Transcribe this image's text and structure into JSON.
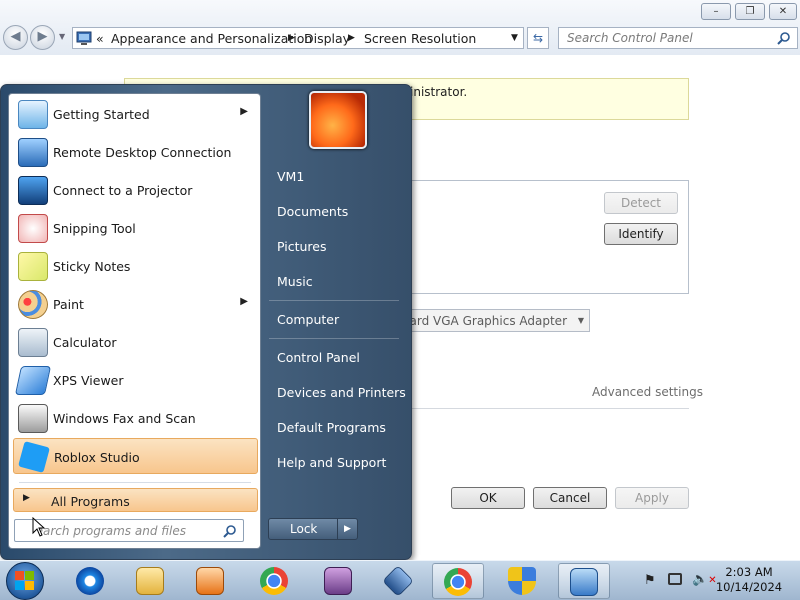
{
  "window": {
    "controls": [
      "–",
      "❐",
      "✕"
    ],
    "address": {
      "segments": [
        "Appearance and Personalization",
        "Display",
        "Screen Resolution"
      ]
    },
    "search_placeholder": "Search Control Panel"
  },
  "content": {
    "infobar_text": "inistrator.",
    "detect_label": "Detect",
    "identify_label": "Identify",
    "adapter_text": "andard VGA Graphics Adapter",
    "advanced_label": "Advanced settings",
    "ok_label": "OK",
    "cancel_label": "Cancel",
    "apply_label": "Apply"
  },
  "start_menu": {
    "programs": [
      {
        "label": "Getting Started",
        "icon": "getting-started-icon",
        "submenu": true
      },
      {
        "label": "Remote Desktop Connection",
        "icon": "remote-desktop-icon",
        "submenu": false
      },
      {
        "label": "Connect to a Projector",
        "icon": "projector-icon",
        "submenu": false
      },
      {
        "label": "Snipping Tool",
        "icon": "scissors-icon",
        "submenu": false
      },
      {
        "label": "Sticky Notes",
        "icon": "sticky-notes-icon",
        "submenu": false
      },
      {
        "label": "Paint",
        "icon": "paint-palette-icon",
        "submenu": true
      },
      {
        "label": "Calculator",
        "icon": "calculator-icon",
        "submenu": false
      },
      {
        "label": "XPS Viewer",
        "icon": "xps-viewer-icon",
        "submenu": false
      },
      {
        "label": "Windows Fax and Scan",
        "icon": "fax-icon",
        "submenu": false
      },
      {
        "label": "Roblox Studio",
        "icon": "roblox-studio-icon",
        "submenu": false,
        "highlighted": true
      }
    ],
    "all_programs": "All Programs",
    "search_placeholder": "Search programs and files",
    "right_links": [
      "VM1",
      "Documents",
      "Pictures",
      "Music",
      "Computer",
      "Control Panel",
      "Devices and Printers",
      "Default Programs",
      "Help and Support"
    ],
    "lock_label": "Lock"
  },
  "taskbar": {
    "items": [
      "internet-explorer-icon",
      "file-explorer-icon",
      "media-player-icon",
      "chrome-icon",
      "winrar-icon",
      "virtualbox-icon",
      "chrome-icon",
      "security-shield-icon",
      "remote-display-icon"
    ],
    "time": "2:03 AM",
    "date": "10/14/2024"
  },
  "colors": {
    "highlight": "#f8c68d",
    "start_menu_panel": "#4c6a88",
    "taskbar": "#b5c9de"
  }
}
